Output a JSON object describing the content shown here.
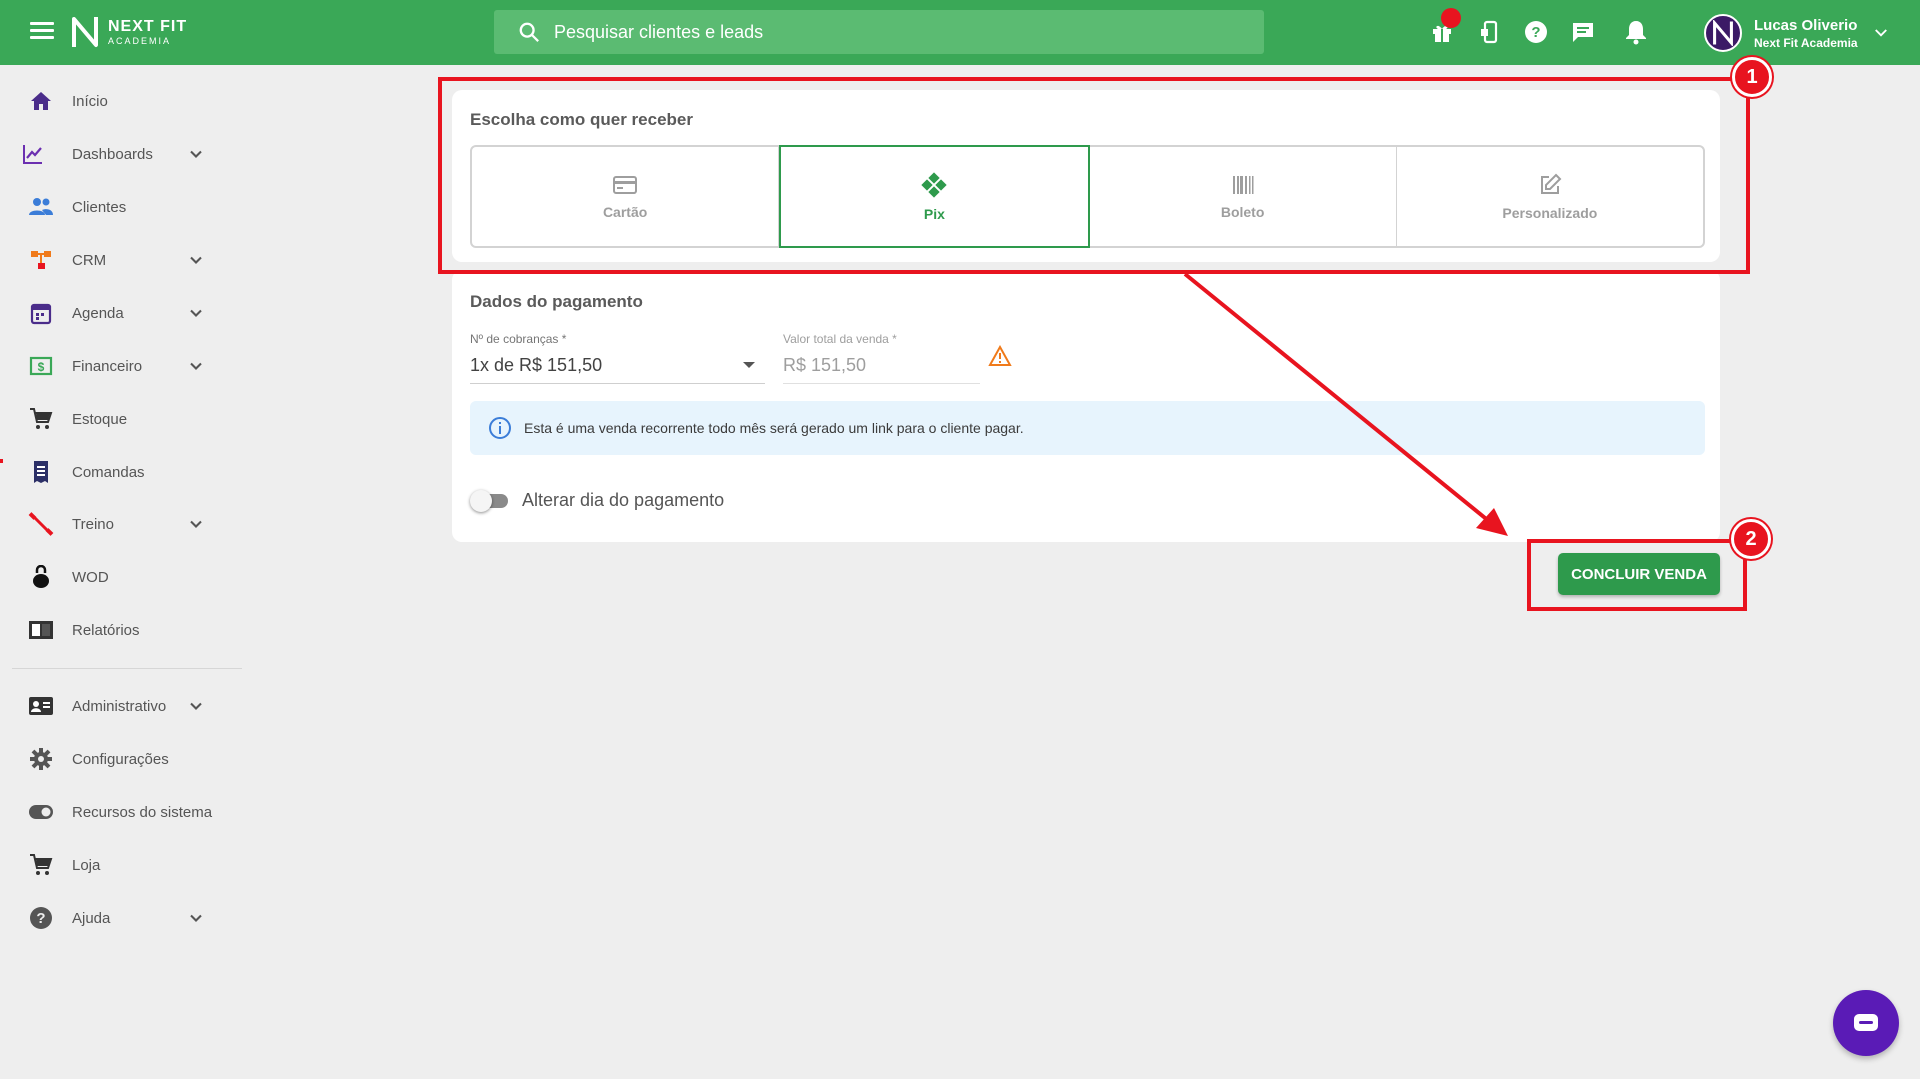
{
  "topbar": {
    "logo_line1": "NEXT FIT",
    "logo_line2": "ACADEMIA",
    "search_placeholder": "Pesquisar clientes e leads",
    "icons": [
      "menu-icon",
      "search-icon",
      "gift-icon",
      "phone-icon",
      "help-icon",
      "chat-icon",
      "bell-icon",
      "chevron-down-icon"
    ],
    "user_name": "Lucas Oliverio",
    "user_org": "Next Fit Academia"
  },
  "sidebar": {
    "items": [
      {
        "label": "Início",
        "icon": "home-icon",
        "color": "#4a2c8a"
      },
      {
        "label": "Dashboards",
        "icon": "chart-line-icon",
        "color": "#6b2fb0"
      },
      {
        "label": "Clientes",
        "icon": "people-icon",
        "color": "#3b7dd8"
      },
      {
        "label": "CRM",
        "icon": "crm-icon",
        "color": "#f07a1a"
      },
      {
        "label": "Agenda",
        "icon": "calendar-icon",
        "color": "#4a2c8a"
      },
      {
        "label": "Financeiro",
        "icon": "money-icon",
        "color": "#3aa857"
      },
      {
        "label": "Estoque",
        "icon": "cart-icon",
        "color": "#333333"
      },
      {
        "label": "Comandas",
        "icon": "receipt-icon",
        "color": "#2b2f66"
      },
      {
        "label": "Treino",
        "icon": "dumbbell-icon",
        "color": "#e8141f"
      },
      {
        "label": "WOD",
        "icon": "kettlebell-icon",
        "color": "#111111"
      },
      {
        "label": "Relatórios",
        "icon": "report-icon",
        "color": "#333333"
      },
      {
        "label": "Administrativo",
        "icon": "id-card-icon",
        "color": "#333333"
      },
      {
        "label": "Configurações",
        "icon": "gear-icon",
        "color": "#555555"
      },
      {
        "label": "Recursos do sistema",
        "icon": "toggle-icon",
        "color": "#555555"
      },
      {
        "label": "Loja",
        "icon": "cart-icon",
        "color": "#333333"
      },
      {
        "label": "Ajuda",
        "icon": "help-icon",
        "color": "#555555"
      }
    ]
  },
  "receive": {
    "title": "Escolha como quer receber",
    "methods": [
      {
        "label": "Cartão",
        "icon": "credit-card-icon",
        "selected": false
      },
      {
        "label": "Pix",
        "icon": "pix-icon",
        "selected": true
      },
      {
        "label": "Boleto",
        "icon": "barcode-icon",
        "selected": false
      },
      {
        "label": "Personalizado",
        "icon": "edit-icon",
        "selected": false
      }
    ]
  },
  "payment": {
    "title": "Dados do pagamento",
    "installments_label": "Nº de cobranças *",
    "installments_value": "1x de R$ 151,50",
    "total_label": "Valor total da venda *",
    "total_value": "R$ 151,50",
    "info_text": "Esta é uma venda recorrente todo mês será gerado um link para o cliente pagar.",
    "toggle_label": "Alterar dia do pagamento",
    "toggle_on": false
  },
  "actions": {
    "conclude_label": "CONCLUIR VENDA"
  },
  "annotations": {
    "badge1": "1",
    "badge2": "2",
    "color": "#e8141f"
  },
  "colors": {
    "brand_green": "#3aa857",
    "selected_green": "#2e9a4c",
    "chat_purple": "#5a1bb6"
  }
}
